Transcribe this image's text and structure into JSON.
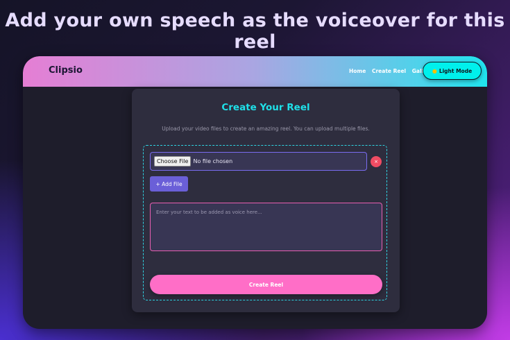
{
  "headline": "Add your own speech as the voiceover for this reel",
  "navbar": {
    "brand": "Clipsio",
    "links": [
      "Home",
      "Create Reel",
      "Gallery"
    ],
    "theme_button": {
      "icon": "sun-icon",
      "label": "Light Mode"
    }
  },
  "card": {
    "title": "Create Your Reel",
    "subtitle": "Upload your video files to create an amazing reel. You can upload multiple files.",
    "file_input": {
      "button_label": "Choose File",
      "status": "No file chosen"
    },
    "remove_icon": "×",
    "add_file_label": "+ Add File",
    "voice_text": {
      "value": "",
      "placeholder": "Enter your text to be added as voice here..."
    },
    "create_label": "Create Reel"
  },
  "colors": {
    "accent_cyan": "#1fe0e8",
    "accent_pink": "#ff6ec7",
    "accent_purple": "#6a5fd8",
    "danger": "#ef4c63"
  }
}
